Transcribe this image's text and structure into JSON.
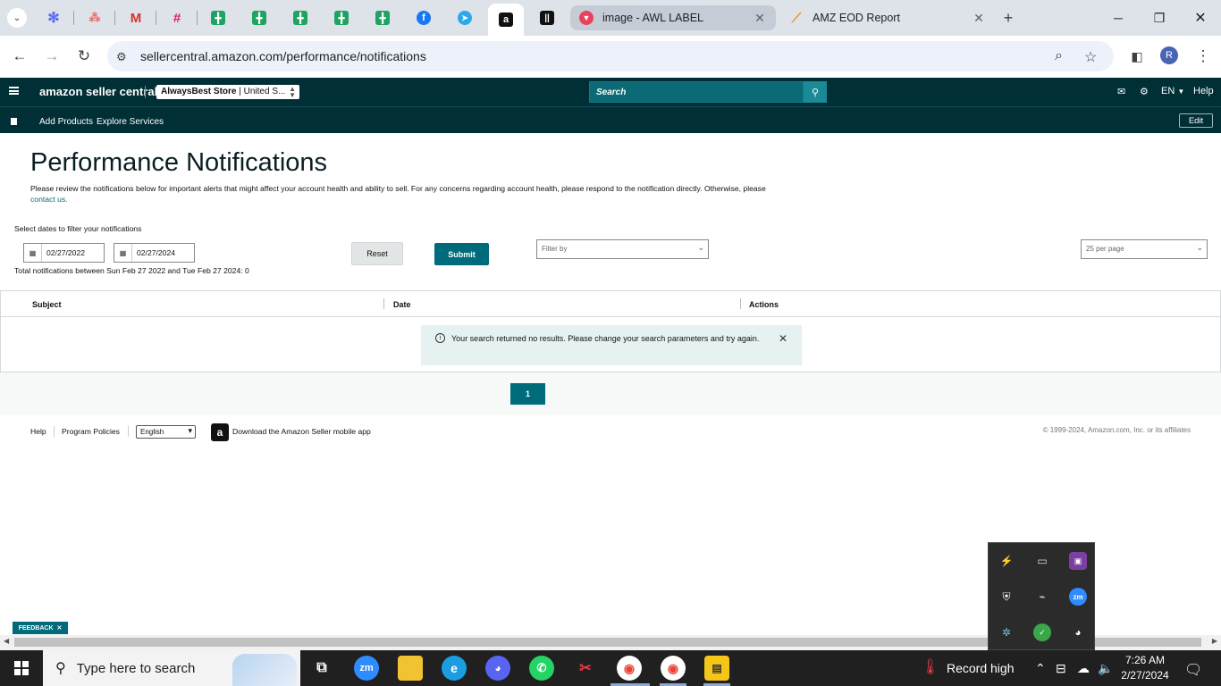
{
  "browser": {
    "pinned_tabs": [
      {
        "icon": "chevron-down-icon"
      },
      {
        "icon": "asterisk-app-icon",
        "color": "#5b6cf0"
      },
      {
        "icon": "asana-icon",
        "color": "#f06a6a"
      },
      {
        "icon": "gmail-icon",
        "color": "#d93025"
      },
      {
        "icon": "slack-icon",
        "color": "#e01e5a"
      },
      {
        "icon": "sheets-icon",
        "color": "#1ea362"
      },
      {
        "icon": "sheets-icon",
        "color": "#1ea362"
      },
      {
        "icon": "sheets-icon",
        "color": "#1ea362"
      },
      {
        "icon": "sheets-icon",
        "color": "#1ea362"
      },
      {
        "icon": "sheets-icon",
        "color": "#1ea362"
      },
      {
        "icon": "facebook-icon",
        "color": "#1877f2"
      },
      {
        "icon": "telegram-icon",
        "color": "#29a9eb"
      },
      {
        "icon": "amazon-icon",
        "color": "#111111"
      },
      {
        "icon": "bars-app-icon",
        "color": "#111111"
      }
    ],
    "tabs": [
      {
        "title": "image - AWL LABEL",
        "icon": "triangle-logo-icon"
      },
      {
        "title": "AMZ EOD Report",
        "icon": "document-logo-icon"
      }
    ],
    "url": "sellercentral.amazon.com/performance/notifications",
    "profile_initial": "R"
  },
  "amazon": {
    "logo_text": "amazon seller central",
    "store_name": "AlwaysBest Store",
    "store_region": "| United S...",
    "search_placeholder": "Search",
    "language": "EN",
    "help": "Help",
    "sub_nav": [
      "Add Products",
      "Explore Services"
    ],
    "edit_label": "Edit"
  },
  "page": {
    "title": "Performance Notifications",
    "description": "Please review the notifications below for important alerts that might affect your account health and ability to sell. For any concerns regarding account health, please respond to the notification directly. Otherwise, please",
    "contact_link": "contact us.",
    "filter_label": "Select dates to filter your notifications",
    "date_from": "02/27/2022",
    "date_to": "02/27/2024",
    "total_line": "Total notifications between Sun Feb 27 2022 and Tue Feb 27 2024: 0",
    "reset_label": "Reset",
    "submit_label": "Submit",
    "filter_placeholder": "Filter by",
    "per_page": "25 per page",
    "columns": [
      "Subject",
      "Date",
      "Actions"
    ],
    "alert_message": "Your search returned no results. Please change your search parameters and try again.",
    "current_page": "1",
    "feedback_label": "FEEDBACK"
  },
  "footer": {
    "help": "Help",
    "program_policies": "Program Policies",
    "language": "English",
    "app_download": "Download the Amazon Seller mobile app",
    "copyright": "© 1999-2024, Amazon.com, Inc. or its affiliates"
  },
  "taskbar": {
    "search_placeholder": "Type here to search",
    "weather_text": "Record high",
    "time": "7:26 AM",
    "date": "2/27/2024",
    "zoom_label": "zm"
  }
}
